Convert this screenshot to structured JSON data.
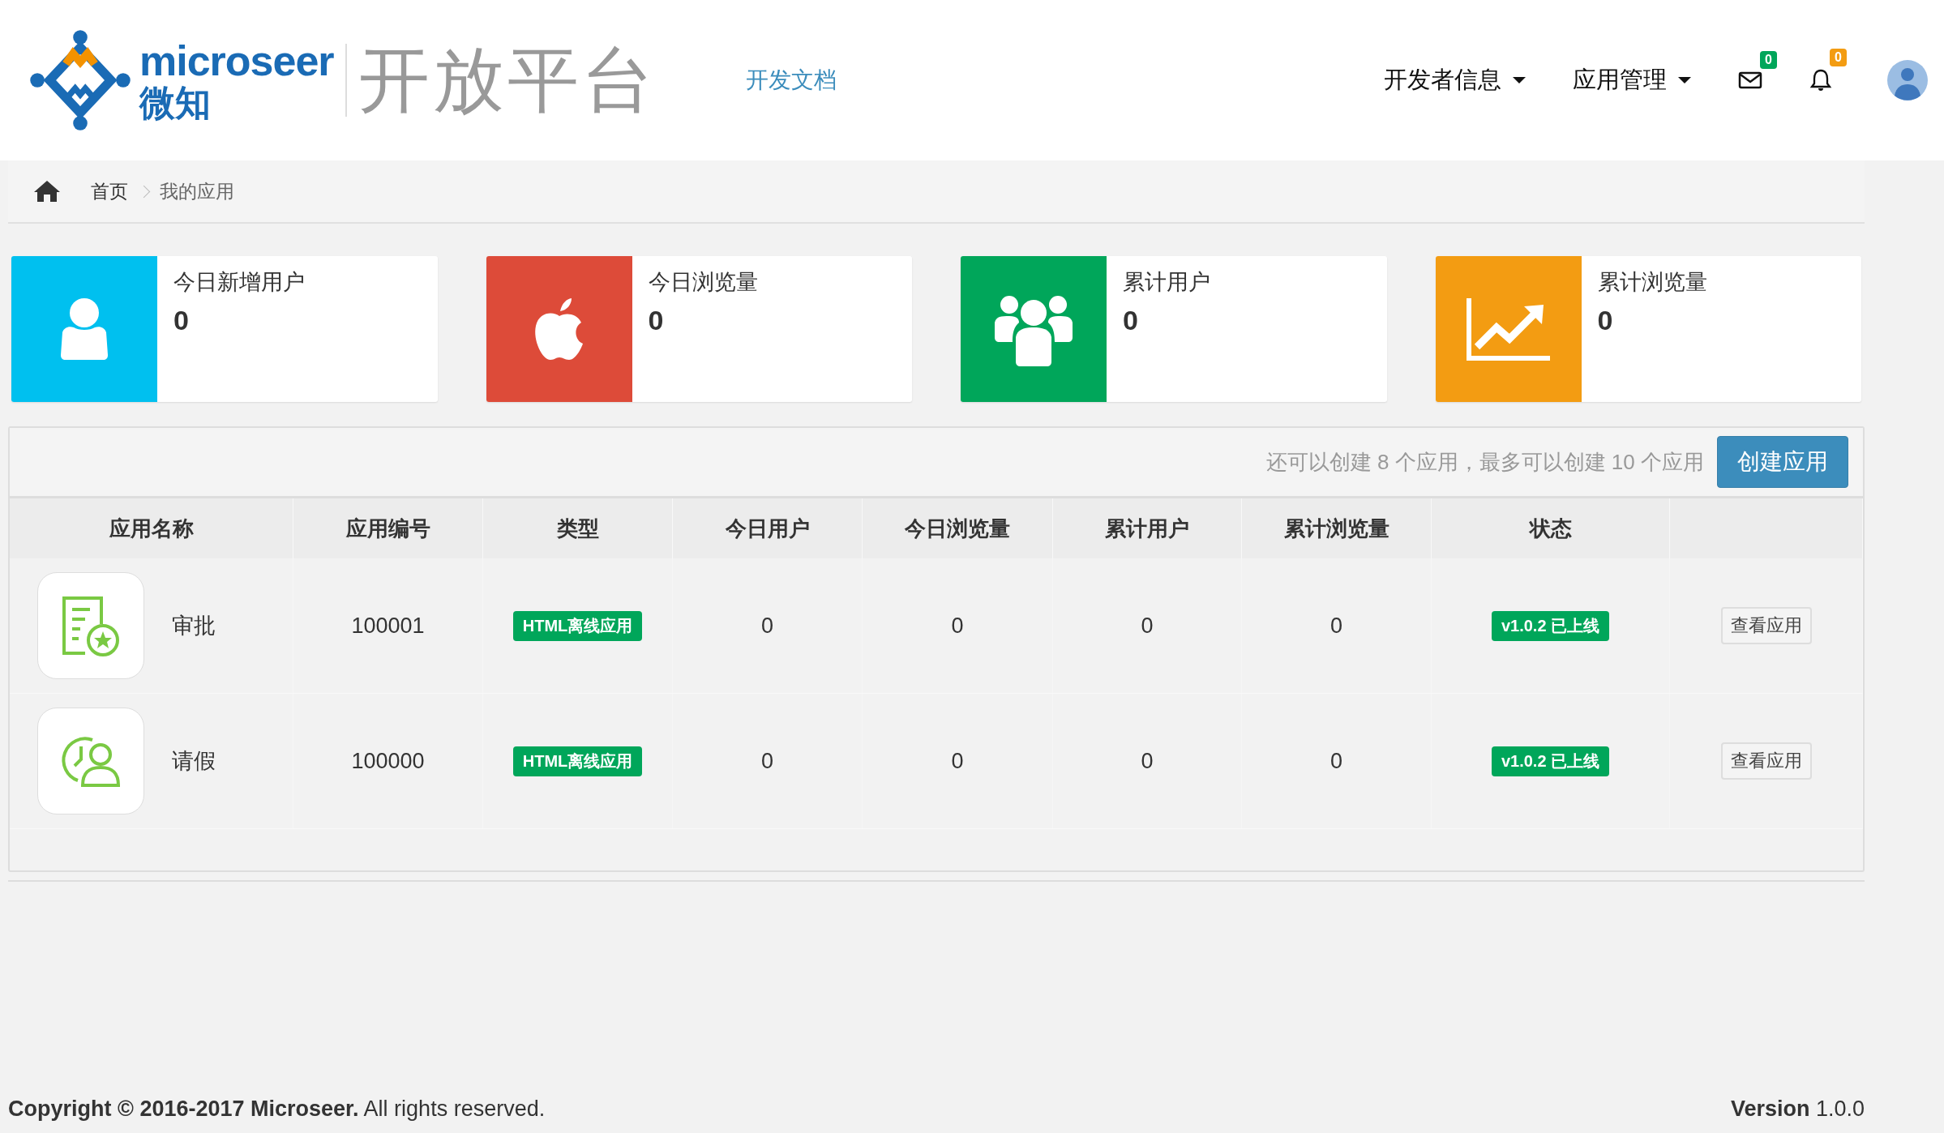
{
  "header": {
    "logo_text": "microseer",
    "logo_subtext": "微知",
    "platform_title": "开放平台",
    "doc_link": "开发文档",
    "menus": [
      {
        "label": "开发者信息"
      },
      {
        "label": "应用管理"
      }
    ],
    "notifications": [
      {
        "kind": "mail",
        "count": "0",
        "color": "#00a65a"
      },
      {
        "kind": "bell",
        "count": "0",
        "color": "#f39c12"
      }
    ]
  },
  "breadcrumb": [
    "首页",
    "我的应用"
  ],
  "stats": [
    {
      "label": "今日新增用户",
      "value": "0",
      "kind": "user",
      "color": "#00c0ef"
    },
    {
      "label": "今日浏览量",
      "value": "0",
      "kind": "apple",
      "color": "#dd4b39"
    },
    {
      "label": "累计用户",
      "value": "0",
      "kind": "users",
      "color": "#00a65a"
    },
    {
      "label": "累计浏览量",
      "value": "0",
      "kind": "chart",
      "color": "#f39c12"
    }
  ],
  "toolbar": {
    "hint": "还可以创建 8 个应用，最多可以创建 10 个应用",
    "button": "创建应用"
  },
  "table": {
    "columns": [
      "应用名称",
      "应用编号",
      "类型",
      "今日用户",
      "今日浏览量",
      "累计用户",
      "累计浏览量",
      "状态"
    ],
    "rows": [
      {
        "kind": "approval",
        "name": "审批",
        "id": "100001",
        "type": "HTML离线应用",
        "today_users": "0",
        "today_views": "0",
        "total_users": "0",
        "total_views": "0",
        "status": "v1.0.2 已上线",
        "action": "查看应用"
      },
      {
        "kind": "leave",
        "name": "请假",
        "id": "100000",
        "type": "HTML离线应用",
        "today_users": "0",
        "today_views": "0",
        "total_users": "0",
        "total_views": "0",
        "status": "v1.0.2 已上线",
        "action": "查看应用"
      }
    ]
  },
  "footer": {
    "copyright": "**Copyright © 2016-2017 Microseer.** All rights reserved.",
    "version": "**Version** 1.0.0"
  }
}
